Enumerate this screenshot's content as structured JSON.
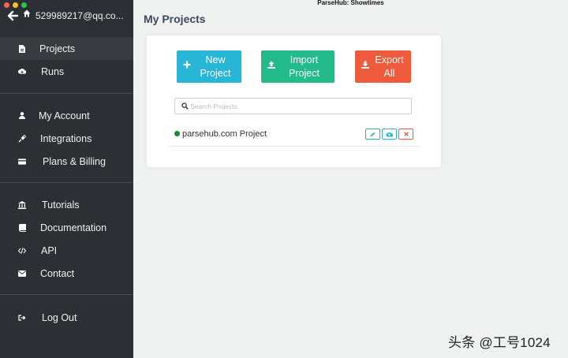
{
  "window": {
    "title": "ParseHub: Showtimes"
  },
  "colors": {
    "sidebar_bg": "#2c3035",
    "new_button": "#27b6d6",
    "import_button": "#24bb8a",
    "export_button": "#ee5a3c",
    "status_dot": "#178a2f"
  },
  "account": {
    "email": "529989217@qq.co..."
  },
  "sidebar": {
    "main": [
      {
        "label": "Projects",
        "icon": "file-icon",
        "active": true
      },
      {
        "label": "Runs",
        "icon": "cloud-download-icon",
        "active": false
      }
    ],
    "account": [
      {
        "label": "My Account",
        "icon": "user-icon"
      },
      {
        "label": "Integrations",
        "icon": "plug-icon"
      },
      {
        "label": "Plans & Billing",
        "icon": "credit-card-icon"
      }
    ],
    "help": [
      {
        "label": "Tutorials",
        "icon": "institution-icon"
      },
      {
        "label": "Documentation",
        "icon": "book-icon"
      },
      {
        "label": "API",
        "icon": "code-icon"
      },
      {
        "label": "Contact",
        "icon": "envelope-icon"
      }
    ],
    "logout": {
      "label": "Log Out",
      "icon": "sign-out-icon"
    }
  },
  "main": {
    "title": "My Projects",
    "buttons": {
      "new": {
        "line1": "New",
        "line2": "Project"
      },
      "import": {
        "line1": "Import",
        "line2": "Project"
      },
      "export": {
        "line1": "Export",
        "line2": "All"
      }
    },
    "search": {
      "placeholder": "Search Projects",
      "value": ""
    },
    "projects": [
      {
        "name": "parsehub.com Project",
        "status": "active"
      }
    ]
  },
  "watermark": "头条 @工号1024"
}
